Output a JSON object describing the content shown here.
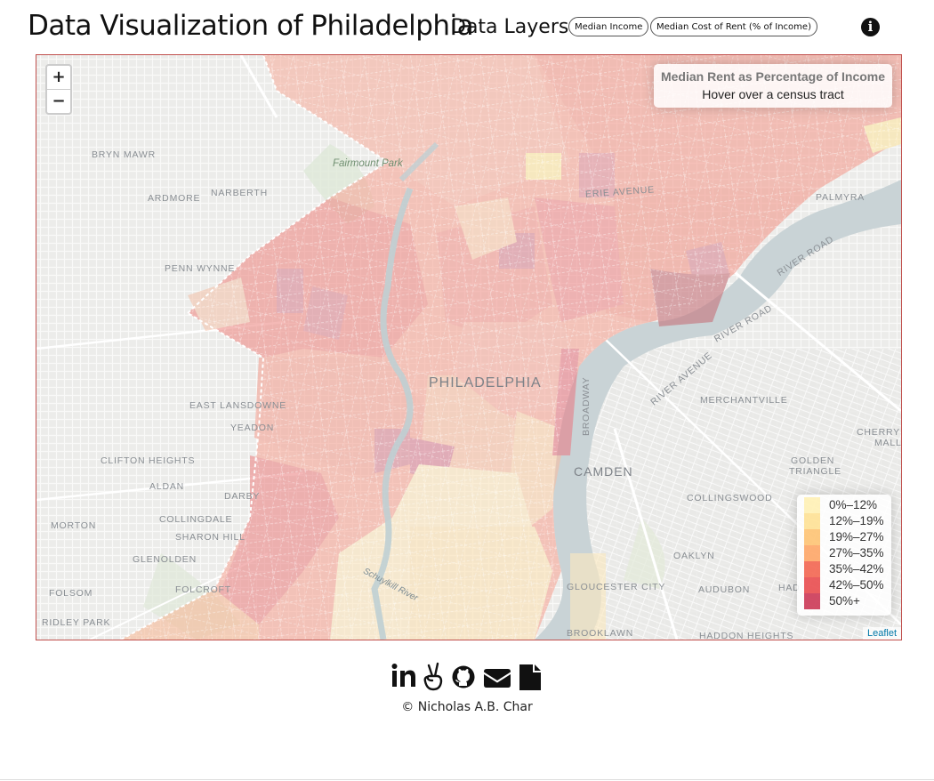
{
  "header": {
    "title": "Data Visualization of Philadelphia",
    "layers_label": "Data Layers:",
    "layer_buttons": [
      "Median Income",
      "Median Cost of Rent (% of Income)"
    ],
    "info_icon": "info-circle-icon"
  },
  "map": {
    "zoom_in": "+",
    "zoom_out": "−",
    "info_box": {
      "heading": "Median Rent as Percentage of Income",
      "subtext": "Hover over a census tract"
    },
    "legend": [
      {
        "label": "0%–12%",
        "color": "#ffeda0"
      },
      {
        "label": "12%–19%",
        "color": "#fed976"
      },
      {
        "label": "19%–27%",
        "color": "#feb24c"
      },
      {
        "label": "27%–35%",
        "color": "#fd8d3c"
      },
      {
        "label": "35%–42%",
        "color": "#f03b20"
      },
      {
        "label": "42%–50%",
        "color": "#e31a1c"
      },
      {
        "label": "50%+",
        "color": "#bd0026"
      }
    ],
    "attribution": "Leaflet",
    "places": {
      "bryn_mawr": "BRYN MAWR",
      "fairmount_park": "Fairmount Park",
      "ardmore": "ARDMORE",
      "narberth": "NARBERTH",
      "palmyra": "PALMYRA",
      "erie_avenue": "ERIE AVENUE",
      "penn_wynne": "PENN WYNNE",
      "river_road": "RIVER ROAD",
      "river_road_2": "RIVER ROAD",
      "philadelphia": "PHILADELPHIA",
      "river_avenue": "RIVER AVENUE",
      "merchantville": "MERCHANTVILLE",
      "east_lansdowne": "EAST LANSDOWNE",
      "yeadon": "YEADON",
      "cherry_hill_1": "CHERRY H",
      "cherry_hill_2": "MALL",
      "clifton_heights": "CLIFTON HEIGHTS",
      "broadway": "BROADWAY",
      "camden": "CAMDEN",
      "golden_1": "GOLDEN",
      "golden_2": "TRIANGLE",
      "aldan": "ALDAN",
      "darby": "DARBY",
      "collingswood": "COLLINGSWOOD",
      "collingdale": "COLLINGDALE",
      "morton": "MORTON",
      "sharon_hill": "SHARON HILL",
      "glenolden": "GLENOLDEN",
      "oaklyn": "OAKLYN",
      "schuylkill_river": "Schuylkill River",
      "folsom": "FOLSOM",
      "folcroft": "FOLCROFT",
      "gloucester_city": "GLOUCESTER CITY",
      "audubon": "AUDUBON",
      "had": "HAD",
      "ridley_park": "RIDLEY PARK",
      "brooklawn": "BROOKLAWN",
      "haddon_heights": "HADDON HEIGHTS"
    }
  },
  "footer": {
    "icons": [
      "linkedin-icon",
      "angellist-icon",
      "github-icon",
      "email-icon",
      "resume-file-icon"
    ],
    "copyright": "© Nicholas A.B. Char"
  }
}
